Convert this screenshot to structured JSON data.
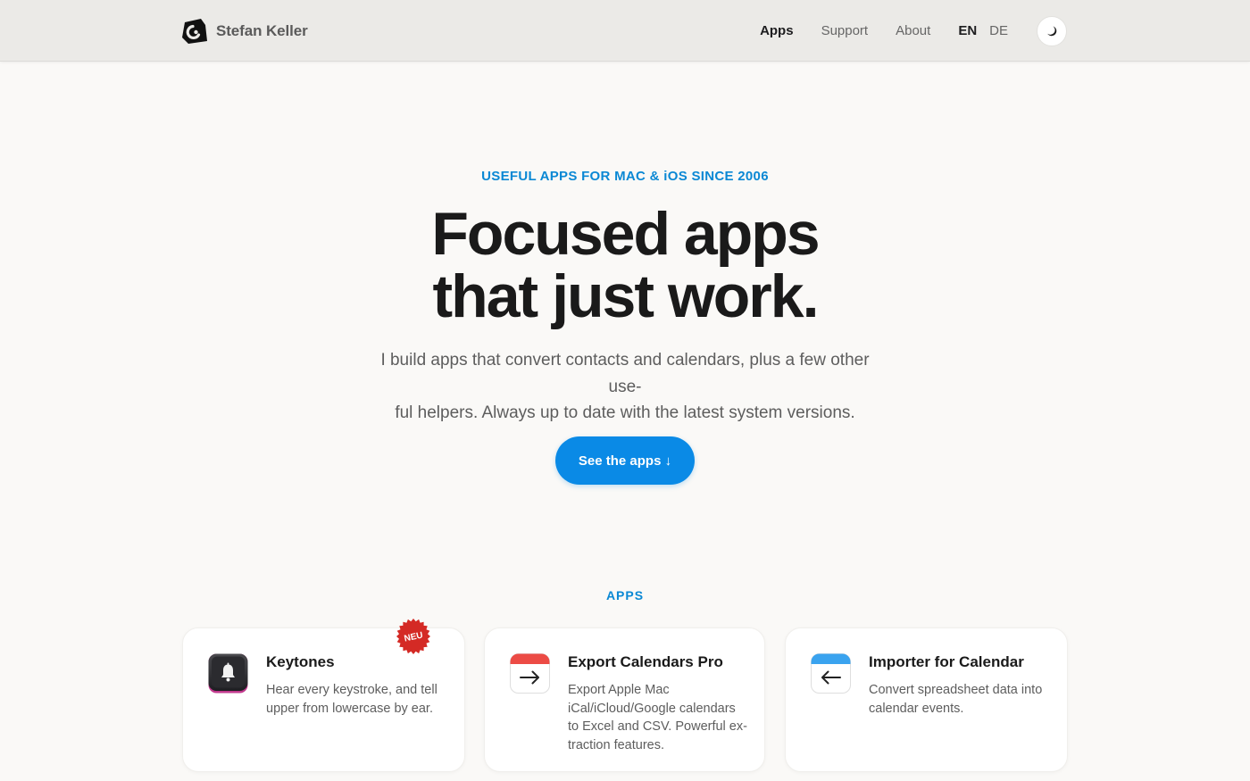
{
  "header": {
    "brand_name": "Stefan Keller",
    "nav": [
      {
        "label": "Apps",
        "active": true
      },
      {
        "label": "Support",
        "active": false
      },
      {
        "label": "About",
        "active": false
      }
    ],
    "languages": [
      {
        "label": "EN",
        "active": true
      },
      {
        "label": "DE",
        "active": false
      }
    ],
    "theme_toggle_icon": "moon-icon"
  },
  "hero": {
    "eyebrow": "USEFUL APPS FOR MAC & iOS SINCE 2006",
    "headline_line1": "Focused apps",
    "headline_line2": "that just work.",
    "subtext_line1": "I build apps that convert contacts and calendars, plus a few other use-",
    "subtext_line2": "ful helpers. Always up to date with the latest system versions.",
    "cta_label": "See the apps ↓"
  },
  "apps_section": {
    "label": "APPS",
    "apps": [
      {
        "name": "Keytones",
        "description": "Hear every keystroke, and tell upper from lowercase by ear.",
        "badge": "NEU",
        "icon": "bell-icon"
      },
      {
        "name": "Export Calendars Pro",
        "description": "Export Apple Mac iCal/iCloud/Google calendars to Excel and CSV. Powerful ex-traction features.",
        "icon": "calendar-export-icon"
      },
      {
        "name": "Importer for Calendar",
        "description": "Convert spreadsheet data into calendar events.",
        "icon": "calendar-import-icon"
      }
    ]
  },
  "colors": {
    "accent": "#0a8ae6",
    "eyebrow": "#0a88d4",
    "badge": "#d42a25",
    "export_icon_top": "#ec4b45",
    "import_icon_top": "#3aa3ef"
  }
}
